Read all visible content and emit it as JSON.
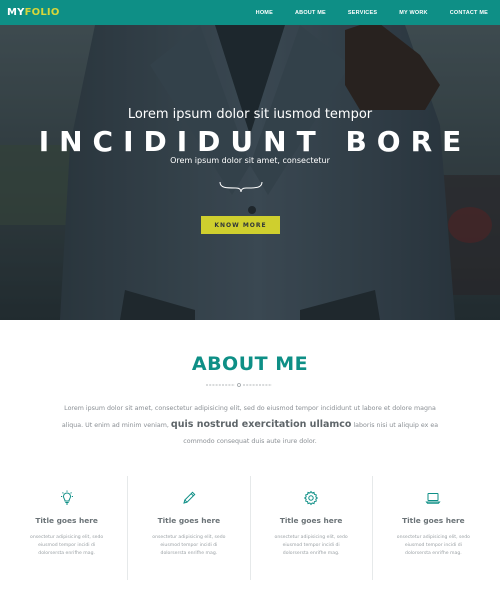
{
  "brand": {
    "logo_part1": "MY",
    "logo_part2": "FOLIO"
  },
  "nav": {
    "items": [
      {
        "label": "HOME"
      },
      {
        "label": "ABOUT ME"
      },
      {
        "label": "SERVICES"
      },
      {
        "label": "MY WORK"
      },
      {
        "label": "CONTACT ME"
      }
    ]
  },
  "hero": {
    "kicker": "Lorem ipsum dolor sit iusmod tempor",
    "title": "INCIDIDUNT BORE",
    "subtitle": "Orem ipsum dolor sit amet, consectetur",
    "button_label": "KNOW MORE"
  },
  "about": {
    "title": "ABOUT ME",
    "text_part1": "Lorem ipsum dolor sit amet, consectetur adipisicing elit, sed do eiusmod tempor incididunt ut labore et dolore magna aliqua. Ut enim ad minim veniam,",
    "text_strong": "quis nostrud exercitation ullamco",
    "text_part2": "laboris nisi ut aliquip ex ea commodo consequat duis aute irure dolor."
  },
  "features": [
    {
      "icon": "lightbulb-icon",
      "title": "Title goes here",
      "desc": "onsectetur adipisicing elit, sedo eiusmod tempor incidi di dolorsersta enrifhe mag."
    },
    {
      "icon": "pencil-icon",
      "title": "Title goes here",
      "desc": "onsectetur adipisicing elit, sedo eiusmod tempor incidi di dolorsersta enrifhe mag."
    },
    {
      "icon": "gear-icon",
      "title": "Title goes here",
      "desc": "onsectetur adipisicing elit, sedo eiusmod tempor incidi di dolorsersta enrifhe mag."
    },
    {
      "icon": "laptop-icon",
      "title": "Title goes here",
      "desc": "onsectetur adipisicing elit, sedo eiusmod tempor incidi di dolorsersta enrifhe mag."
    }
  ],
  "colors": {
    "accent": "#0e8f86",
    "highlight": "#cfcf2e"
  }
}
